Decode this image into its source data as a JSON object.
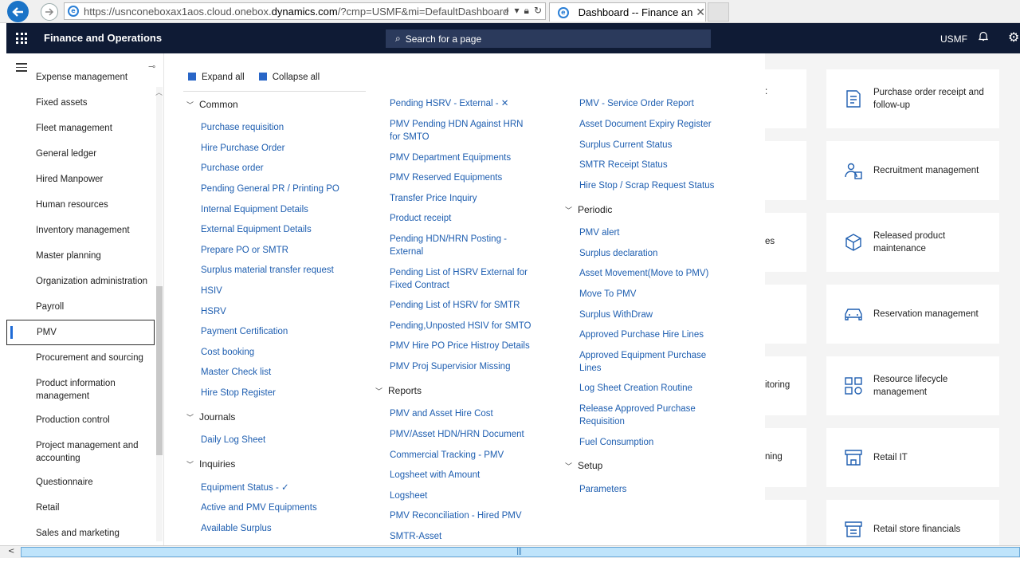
{
  "browser": {
    "url_prefix": "https://usnconeboxax1aos.cloud.onebox.",
    "url_domain": "dynamics.com",
    "url_suffix": "/?cmp=USMF&mi=DefaultDashboard",
    "tab_title": "Dashboard -- Finance and ...",
    "ie_glyph": "e"
  },
  "header": {
    "app_title": "Finance and Operations",
    "search_placeholder": "Search for a page",
    "company": "USMF"
  },
  "sidebar": {
    "items": [
      {
        "label": "Expense management"
      },
      {
        "label": "Fixed assets"
      },
      {
        "label": "Fleet management"
      },
      {
        "label": "General ledger"
      },
      {
        "label": "Hired Manpower"
      },
      {
        "label": "Human resources"
      },
      {
        "label": "Inventory management"
      },
      {
        "label": "Master planning"
      },
      {
        "label": "Organization administration"
      },
      {
        "label": "Payroll"
      },
      {
        "label": "PMV"
      },
      {
        "label": "Procurement and sourcing"
      },
      {
        "label": "Product information management"
      },
      {
        "label": "Production control"
      },
      {
        "label": "Project management and accounting"
      },
      {
        "label": "Questionnaire"
      },
      {
        "label": "Retail"
      },
      {
        "label": "Sales and marketing"
      }
    ]
  },
  "flyout": {
    "expand_all": "Expand all",
    "collapse_all": "Collapse all",
    "col1": {
      "common_title": "Common",
      "common": [
        "Purchase requisition",
        "Hire Purchase Order",
        "Purchase order",
        "Pending General PR / Printing PO",
        "Internal Equipment Details",
        "External Equipment Details",
        "Prepare PO or SMTR",
        "Surplus material transfer request",
        "HSIV",
        "HSRV",
        "Payment Certification",
        "Cost booking",
        "Master Check list",
        "Hire Stop Register"
      ],
      "journals_title": "Journals",
      "journals": [
        "Daily Log Sheet"
      ],
      "inquiries_title": "Inquiries",
      "inquiries": [
        "Equipment Status - ✓",
        "Active and PMV Equipments",
        "Available Surplus"
      ]
    },
    "col2": {
      "common": [
        "Pending HSRV - External - ✕",
        "PMV Pending HDN Against HRN for SMTO",
        "PMV Department Equipments",
        "PMV Reserved Equipments",
        "Transfer Price Inquiry",
        "Product receipt",
        "Pending HDN/HRN Posting - External",
        "Pending List of HSRV External for Fixed Contract",
        "Pending List of HSRV for SMTR",
        "Pending,Unposted HSIV for SMTO",
        "PMV Hire PO Price Histroy Details",
        "PMV Proj Supervisior Missing"
      ],
      "reports_title": "Reports",
      "reports": [
        "PMV and Asset Hire Cost",
        "PMV/Asset HDN/HRN Document",
        "Commercial Tracking - PMV",
        "Logsheet with Amount",
        "Logsheet",
        "PMV Reconciliation - Hired PMV",
        "SMTR-Asset"
      ]
    },
    "col3": {
      "reports": [
        "PMV - Service Order Report",
        "Asset Document Expiry Register",
        "Surplus Current Status",
        "SMTR Receipt Status",
        "Hire Stop / Scrap Request Status"
      ],
      "periodic_title": "Periodic",
      "periodic": [
        "PMV alert",
        "Surplus declaration",
        "Asset Movement(Move to PMV)",
        "Move To PMV",
        "Surplus WithDraw",
        "Approved Purchase Hire Lines",
        "Approved Equipment Purchase Lines",
        "Log Sheet Creation Routine",
        "Release Approved Purchase Requisition",
        "Fuel Consumption"
      ],
      "setup_title": "Setup",
      "setup": [
        "Parameters"
      ]
    }
  },
  "tiles": {
    "stubs": [
      ":",
      "",
      "es",
      "",
      "itoring",
      "ning",
      ""
    ],
    "items": [
      {
        "label": "Purchase order receipt and follow-up",
        "icon": "receipt-icon"
      },
      {
        "label": "Recruitment management",
        "icon": "people-icon"
      },
      {
        "label": "Released product maintenance",
        "icon": "box-icon"
      },
      {
        "label": "Reservation management",
        "icon": "car-icon"
      },
      {
        "label": "Resource lifecycle management",
        "icon": "lifecycle-icon"
      },
      {
        "label": "Retail IT",
        "icon": "store-it-icon"
      },
      {
        "label": "Retail store financials",
        "icon": "store-financials-icon"
      }
    ]
  },
  "colors": {
    "header_bg": "#0f1b35",
    "link": "#1e5eb0",
    "accent": "#1f6bd6"
  }
}
